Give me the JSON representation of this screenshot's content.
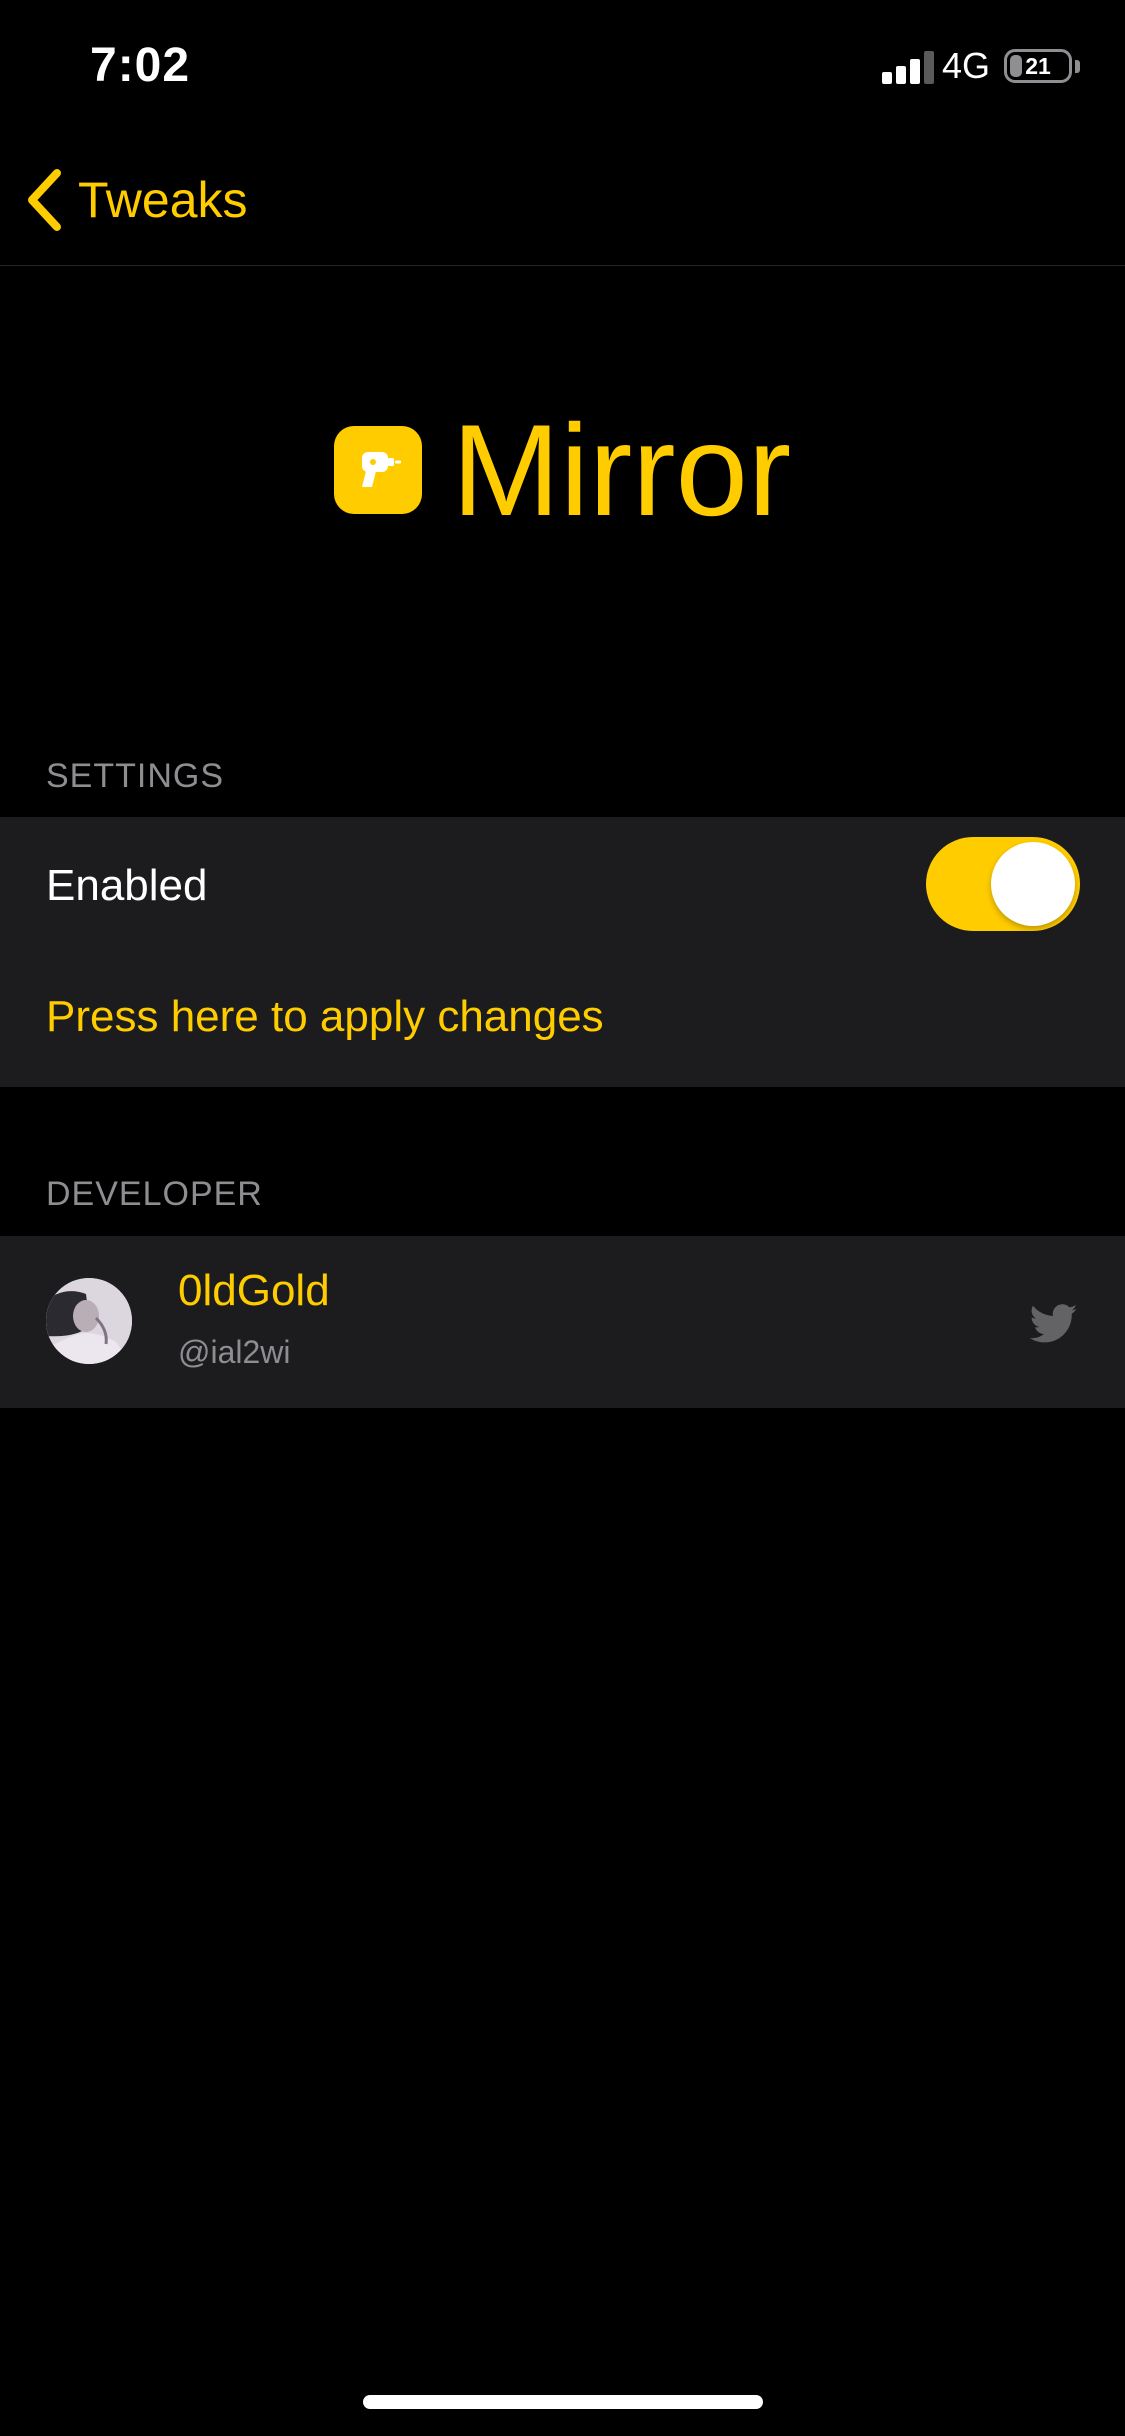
{
  "status_bar": {
    "time": "7:02",
    "network": "4G",
    "battery": "21",
    "battery_level": 0.21
  },
  "nav": {
    "back_label": "Tweaks"
  },
  "header": {
    "title": "Mirror",
    "icon": "drill-icon"
  },
  "settings": {
    "section_title": "SETTINGS",
    "enabled_label": "Enabled",
    "enabled_value": true,
    "apply_label": "Press here to apply changes"
  },
  "developer": {
    "section_title": "DEVELOPER",
    "name": "0ldGold",
    "handle": "@ial2wi",
    "link_icon": "twitter-icon"
  },
  "colors": {
    "accent": "#ffcc00",
    "background": "#000000",
    "cell": "#1c1c1e",
    "secondary_text": "#8d8d92"
  }
}
